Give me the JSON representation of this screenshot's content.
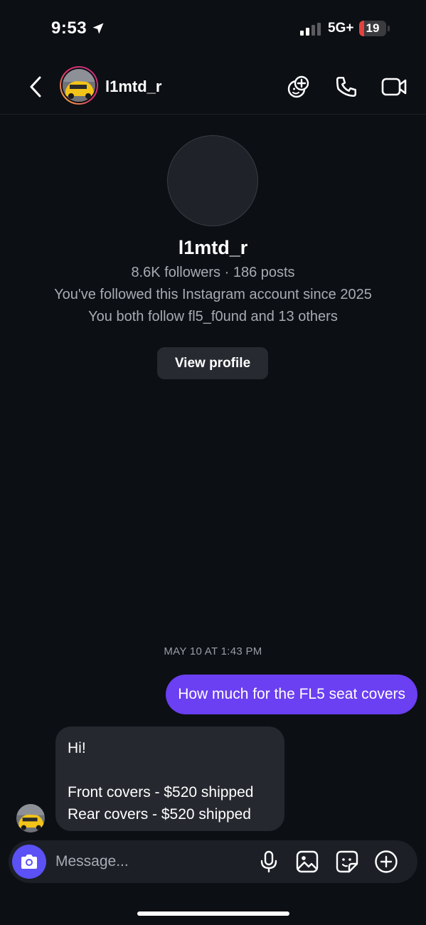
{
  "status_bar": {
    "time": "9:53",
    "network": "5G+",
    "battery_level": "19",
    "battery_fraction": 0.19,
    "battery_color": "#e5413c"
  },
  "header": {
    "username": "l1mtd_r"
  },
  "profile": {
    "name": "l1mtd_r",
    "stats": "8.6K followers · 186 posts",
    "follow_since": "You've followed this Instagram account since 2025",
    "mutuals": "You both follow fl5_f0und and 13 others",
    "view_profile_label": "View profile"
  },
  "thread": {
    "timestamp": "MAY 10 AT 1:43 PM",
    "outgoing": "How much for the FL5 seat covers",
    "incoming_lines": [
      "Hi!",
      "",
      "Front covers - $520 shipped",
      "Rear covers - $520 shipped"
    ]
  },
  "composer": {
    "placeholder": "Message..."
  },
  "colors": {
    "accent": "#6b3ff2",
    "camera": "#5b51f5",
    "background": "#0c0f14"
  },
  "icons": [
    "location-arrow-icon",
    "signal-icon",
    "back-icon",
    "add-people-icon",
    "phone-icon",
    "video-icon",
    "camera-icon",
    "microphone-icon",
    "gallery-icon",
    "sticker-icon",
    "plus-icon"
  ]
}
